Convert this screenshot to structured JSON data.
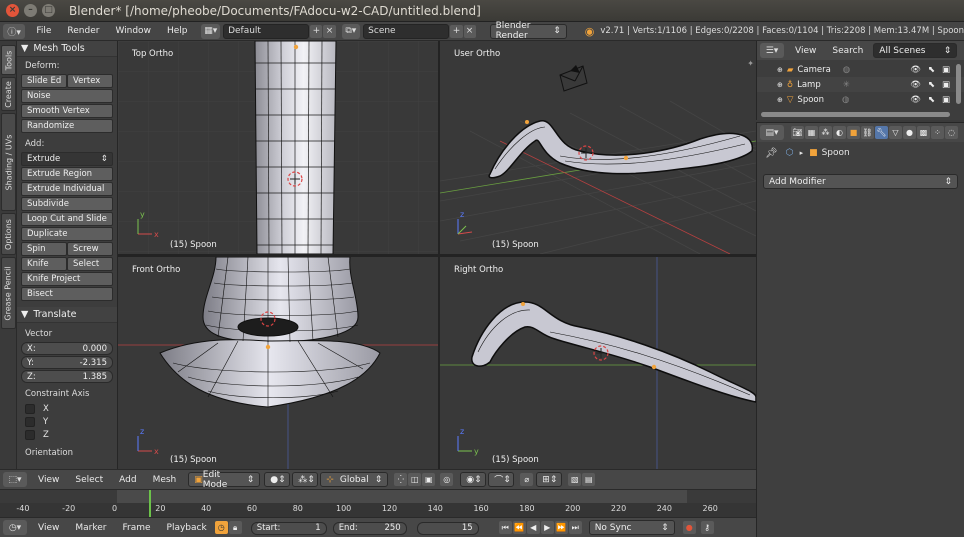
{
  "window": {
    "title": "Blender* [/home/pheobe/Documents/FAdocu-w2-CAD/untitled.blend]"
  },
  "info_header": {
    "menus": [
      "File",
      "Render",
      "Window",
      "Help"
    ],
    "screen_layout": "Default",
    "scene": "Scene",
    "render_engine": "Blender Render",
    "stats": "v2.71 | Verts:1/1106 | Edges:0/2208 | Faces:0/1104 | Tris:2208 | Mem:13.47M | Spoon"
  },
  "tool_tabs": [
    "Tools",
    "Create",
    "Shading / UVs",
    "Options",
    "Grease Pencil"
  ],
  "mesh_tools": {
    "title": "Mesh Tools",
    "deform_label": "Deform:",
    "deform_row": [
      "Slide Ed",
      "Vertex"
    ],
    "deform_buttons": [
      "Noise",
      "Smooth Vertex",
      "Randomize"
    ],
    "add_label": "Add:",
    "extrude_dropdown": "Extrude",
    "add_buttons": [
      "Extrude Region",
      "Extrude Individual",
      "Subdivide",
      "Loop Cut and Slide",
      "Duplicate"
    ],
    "add_row1": [
      "Spin",
      "Screw"
    ],
    "add_row2": [
      "Knife",
      "Select"
    ],
    "add_buttons2": [
      "Knife Project",
      "Bisect"
    ]
  },
  "translate_panel": {
    "title": "Translate",
    "vector_label": "Vector",
    "vector": [
      {
        "axis": "X:",
        "value": "0.000"
      },
      {
        "axis": "Y:",
        "value": "-2.315"
      },
      {
        "axis": "Z:",
        "value": "1.385"
      }
    ],
    "constraint_label": "Constraint Axis",
    "constraint_axes": [
      "X",
      "Y",
      "Z"
    ],
    "orientation_label": "Orientation"
  },
  "viewports": {
    "top_left": {
      "label": "Top Ortho",
      "object": "(15) Spoon"
    },
    "top_right": {
      "label": "User Ortho",
      "object": "(15) Spoon"
    },
    "bottom_left": {
      "label": "Front Ortho",
      "object": "(15) Spoon"
    },
    "bottom_right": {
      "label": "Right Ortho",
      "object": "(15) Spoon"
    }
  },
  "view3d_header": {
    "menus": [
      "View",
      "Select",
      "Add",
      "Mesh"
    ],
    "mode": "Edit Mode",
    "orientation": "Global"
  },
  "timeline": {
    "ticks": [
      "-40",
      "-20",
      "0",
      "20",
      "40",
      "60",
      "80",
      "100",
      "120",
      "140",
      "160",
      "180",
      "200",
      "220",
      "240",
      "260"
    ],
    "current_frame_value": 15,
    "range": {
      "min": -50,
      "max": 280
    },
    "menus": [
      "View",
      "Marker",
      "Frame",
      "Playback"
    ],
    "start_label": "Start:",
    "start": "1",
    "end_label": "End:",
    "end": "250",
    "current_frame": "15",
    "sync": "No Sync"
  },
  "outliner": {
    "menus": [
      "View",
      "Search"
    ],
    "filter": "All Scenes",
    "items": [
      "Camera",
      "Lamp",
      "Spoon"
    ]
  },
  "properties": {
    "object_name": "Spoon",
    "add_modifier": "Add Modifier"
  },
  "colors": {
    "accent_orange": "#f1a33b",
    "x_axis": "#d44a4a",
    "y_axis": "#7bc24f",
    "z_axis": "#5a7bff",
    "window_close": "#e2553a"
  }
}
